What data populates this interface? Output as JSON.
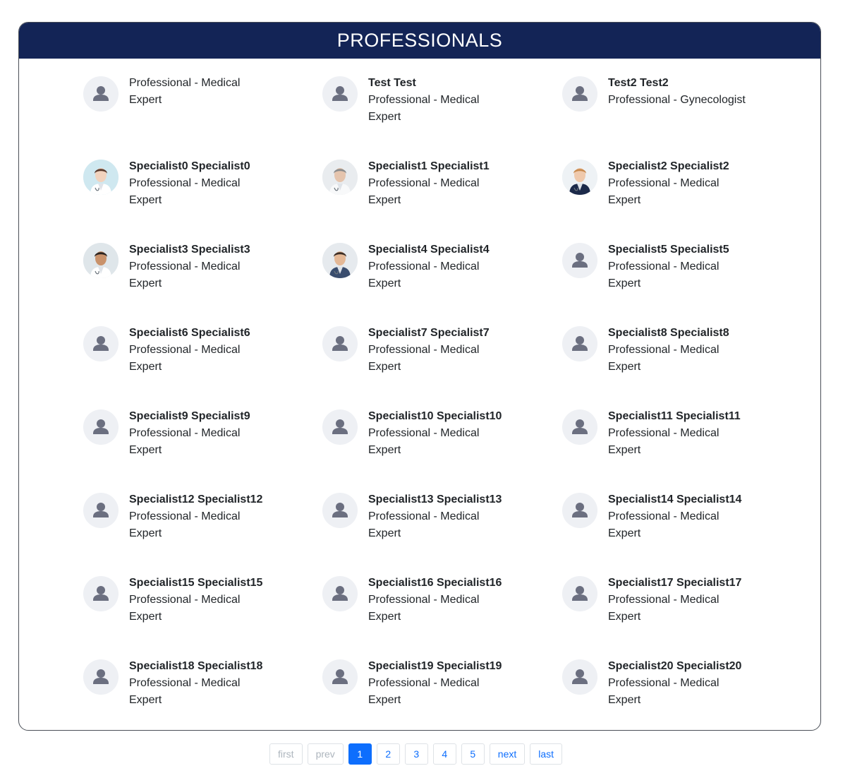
{
  "header": {
    "title": "PROFESSIONALS"
  },
  "colors": {
    "header_bg": "#132456",
    "accent": "#0d6efd",
    "avatar_bg": "#eef0f4",
    "avatar_icon": "#6b6f80"
  },
  "professionals": [
    {
      "name": "",
      "line1": "Professional - Medical",
      "line2": "Expert",
      "avatar": "user-placeholder-icon"
    },
    {
      "name": "Test Test",
      "line1": "Professional - Medical",
      "line2": "Expert",
      "avatar": "user-placeholder-icon"
    },
    {
      "name": "Test2 Test2",
      "line1": "Professional - Gynecologist",
      "line2": "",
      "avatar": "user-placeholder-icon"
    },
    {
      "name": "Specialist0 Specialist0",
      "line1": "Professional - Medical",
      "line2": "Expert",
      "avatar": "doctor-photo"
    },
    {
      "name": "Specialist1 Specialist1",
      "line1": "Professional - Medical",
      "line2": "Expert",
      "avatar": "doctor-photo"
    },
    {
      "name": "Specialist2 Specialist2",
      "line1": "Professional - Medical",
      "line2": "Expert",
      "avatar": "doctor-photo"
    },
    {
      "name": "Specialist3 Specialist3",
      "line1": "Professional - Medical",
      "line2": "Expert",
      "avatar": "doctor-photo"
    },
    {
      "name": "Specialist4 Specialist4",
      "line1": "Professional - Medical",
      "line2": "Expert",
      "avatar": "doctor-photo"
    },
    {
      "name": "Specialist5 Specialist5",
      "line1": "Professional - Medical",
      "line2": "Expert",
      "avatar": "user-placeholder-icon"
    },
    {
      "name": "Specialist6 Specialist6",
      "line1": "Professional - Medical",
      "line2": "Expert",
      "avatar": "user-placeholder-icon"
    },
    {
      "name": "Specialist7 Specialist7",
      "line1": "Professional - Medical",
      "line2": "Expert",
      "avatar": "user-placeholder-icon"
    },
    {
      "name": "Specialist8 Specialist8",
      "line1": "Professional - Medical",
      "line2": "Expert",
      "avatar": "user-placeholder-icon"
    },
    {
      "name": "Specialist9 Specialist9",
      "line1": "Professional - Medical",
      "line2": "Expert",
      "avatar": "user-placeholder-icon"
    },
    {
      "name": "Specialist10 Specialist10",
      "line1": "Professional - Medical",
      "line2": "Expert",
      "avatar": "user-placeholder-icon"
    },
    {
      "name": "Specialist11 Specialist11",
      "line1": "Professional - Medical",
      "line2": "Expert",
      "avatar": "user-placeholder-icon"
    },
    {
      "name": "Specialist12 Specialist12",
      "line1": "Professional - Medical",
      "line2": "Expert",
      "avatar": "user-placeholder-icon"
    },
    {
      "name": "Specialist13 Specialist13",
      "line1": "Professional - Medical",
      "line2": "Expert",
      "avatar": "user-placeholder-icon"
    },
    {
      "name": "Specialist14 Specialist14",
      "line1": "Professional - Medical",
      "line2": "Expert",
      "avatar": "user-placeholder-icon"
    },
    {
      "name": "Specialist15 Specialist15",
      "line1": "Professional - Medical",
      "line2": "Expert",
      "avatar": "user-placeholder-icon"
    },
    {
      "name": "Specialist16 Specialist16",
      "line1": "Professional - Medical",
      "line2": "Expert",
      "avatar": "user-placeholder-icon"
    },
    {
      "name": "Specialist17 Specialist17",
      "line1": "Professional - Medical",
      "line2": "Expert",
      "avatar": "user-placeholder-icon"
    },
    {
      "name": "Specialist18 Specialist18",
      "line1": "Professional - Medical",
      "line2": "Expert",
      "avatar": "user-placeholder-icon"
    },
    {
      "name": "Specialist19 Specialist19",
      "line1": "Professional - Medical",
      "line2": "Expert",
      "avatar": "user-placeholder-icon"
    },
    {
      "name": "Specialist20 Specialist20",
      "line1": "Professional - Medical",
      "line2": "Expert",
      "avatar": "user-placeholder-icon"
    }
  ],
  "pagination": {
    "first": "first",
    "prev": "prev",
    "pages": [
      "1",
      "2",
      "3",
      "4",
      "5"
    ],
    "current": "1",
    "next": "next",
    "last": "last"
  }
}
